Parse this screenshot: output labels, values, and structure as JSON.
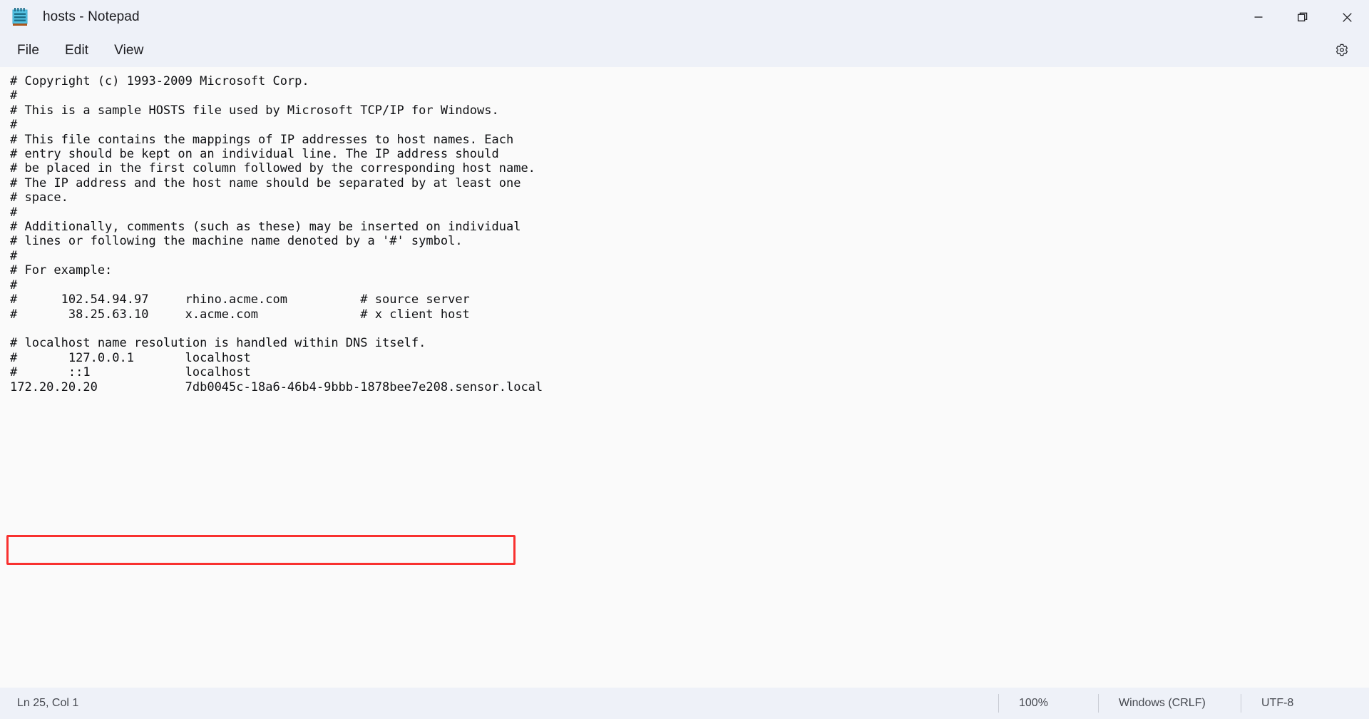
{
  "window": {
    "title": "hosts - Notepad",
    "app_icon": "notepad-icon",
    "controls": {
      "minimize": "minimize-icon",
      "restore": "restore-icon",
      "close": "close-icon"
    }
  },
  "menubar": {
    "items": [
      {
        "label": "File"
      },
      {
        "label": "Edit"
      },
      {
        "label": "View"
      }
    ],
    "settings_icon": "gear-icon"
  },
  "editor": {
    "content": "# Copyright (c) 1993-2009 Microsoft Corp.\n#\n# This is a sample HOSTS file used by Microsoft TCP/IP for Windows.\n#\n# This file contains the mappings of IP addresses to host names. Each\n# entry should be kept on an individual line. The IP address should\n# be placed in the first column followed by the corresponding host name.\n# The IP address and the host name should be separated by at least one\n# space.\n#\n# Additionally, comments (such as these) may be inserted on individual\n# lines or following the machine name denoted by a '#' symbol.\n#\n# For example:\n#\n#      102.54.94.97     rhino.acme.com          # source server\n#       38.25.63.10     x.acme.com              # x client host\n\n# localhost name resolution is handled within DNS itself.\n#\t127.0.0.1       localhost\n#\t::1             localhost\n172.20.20.20            7db0045c-18a6-46b4-9bbb-1878bee7e208.sensor.local",
    "highlighted_entry": {
      "ip": "172.20.20.20",
      "hostname": "7db0045c-18a6-46b4-9bbb-1878bee7e208.sensor.local",
      "highlight_color": "#f8312f"
    }
  },
  "statusbar": {
    "cursor_position": "Ln 25, Col 1",
    "zoom": "100%",
    "line_ending": "Windows (CRLF)",
    "encoding": "UTF-8"
  },
  "colors": {
    "chrome_background": "#eef1f8",
    "editor_background": "#fafafa",
    "text": "#101114",
    "accent_highlight": "#f8312f"
  }
}
